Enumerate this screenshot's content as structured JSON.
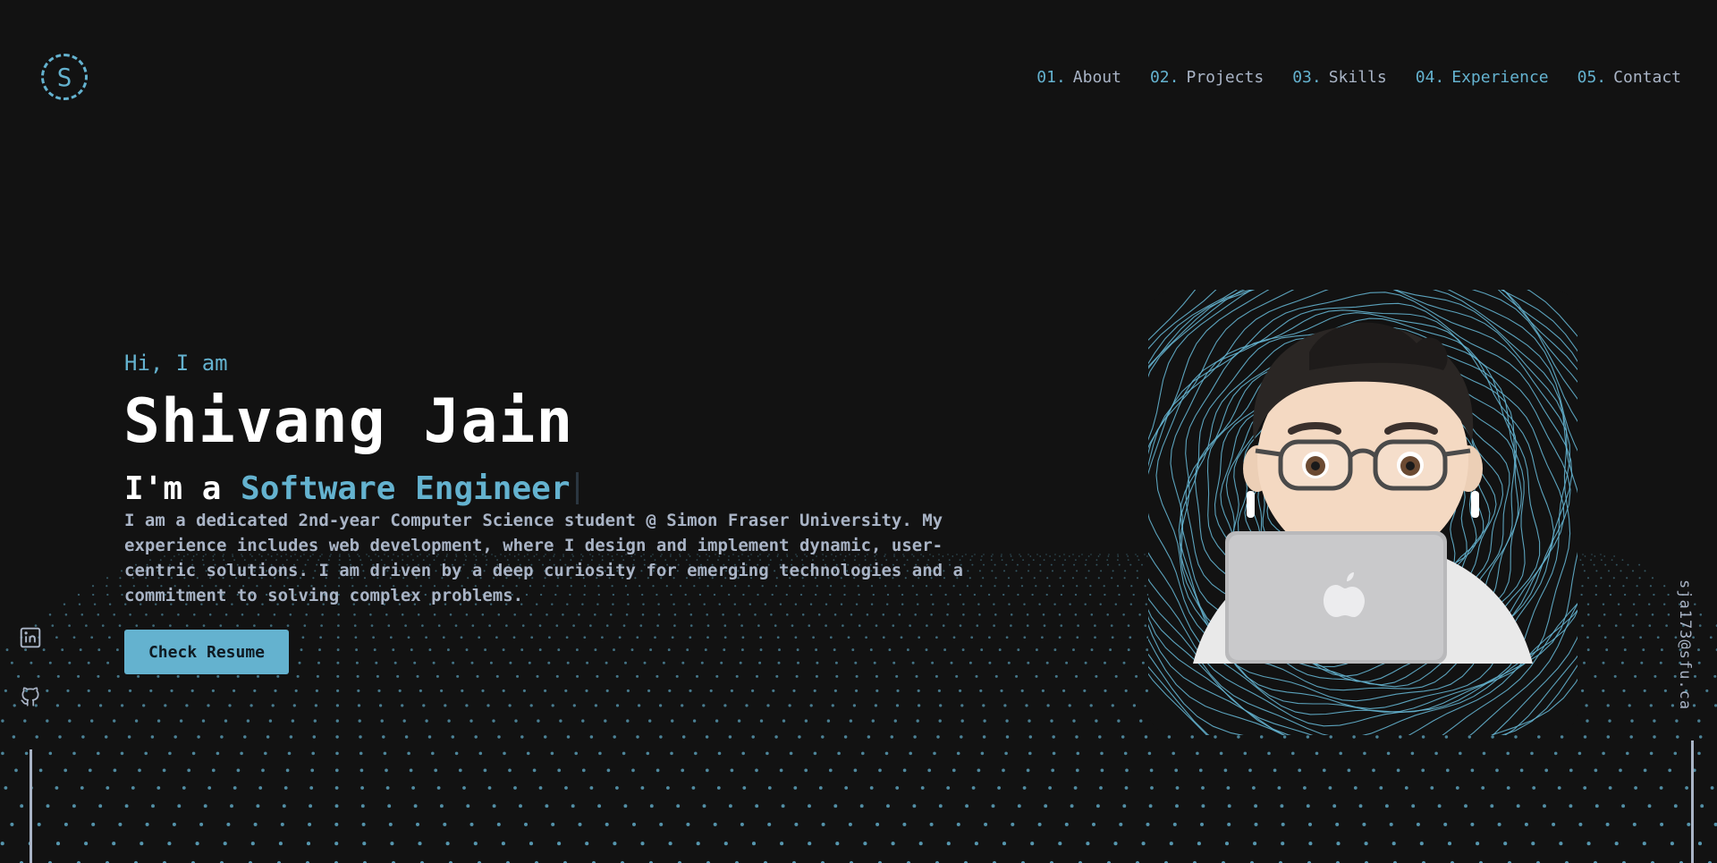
{
  "header": {
    "logo_letter": "S",
    "nav": [
      {
        "num": "01.",
        "label": "About"
      },
      {
        "num": "02.",
        "label": "Projects"
      },
      {
        "num": "03.",
        "label": "Skills"
      },
      {
        "num": "04.",
        "label": "Experience"
      },
      {
        "num": "05.",
        "label": "Contact"
      }
    ]
  },
  "hero": {
    "greeting": "Hi, I am",
    "name": "Shivang Jain",
    "role_prefix": "I'm a ",
    "role": "Software Engineer",
    "bio": "I am a dedicated 2nd-year Computer Science student @ Simon Fraser University. My experience includes web development, where I design and implement dynamic, user-centric solutions. I am driven by a deep curiosity for emerging technologies and a commitment to solving complex problems.",
    "resume_button": "Check Resume"
  },
  "social": {
    "icons": [
      "linkedin-icon",
      "github-icon"
    ],
    "email": "sja173@sfu.ca"
  },
  "colors": {
    "accent": "#64b2cf",
    "background": "#121212",
    "text_muted": "#a9b4c6",
    "text_primary": "#ffffff"
  }
}
